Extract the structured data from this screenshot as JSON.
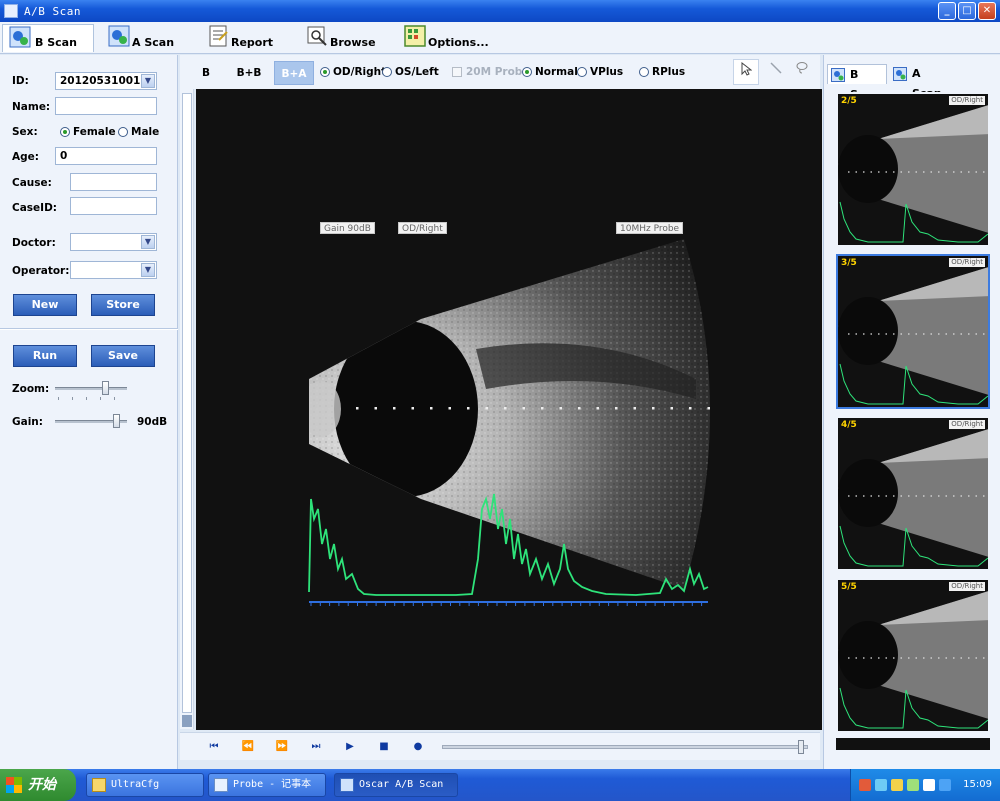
{
  "window": {
    "title": "A/B Scan",
    "controls": {
      "minimize": "_",
      "maximize": "□",
      "close": "✕"
    }
  },
  "toolbar": {
    "items": [
      {
        "label": "B Scan",
        "icon": "b-scan-icon",
        "active": true
      },
      {
        "label": "A Scan",
        "icon": "a-scan-icon",
        "active": false
      },
      {
        "label": "Report",
        "icon": "report-icon",
        "active": false
      },
      {
        "label": "Browse",
        "icon": "browse-icon",
        "active": false
      },
      {
        "label": "Options...",
        "icon": "options-icon",
        "active": false
      }
    ]
  },
  "patient": {
    "id_label": "ID:",
    "id_value": "20120531001",
    "name_label": "Name:",
    "name_value": "",
    "sex_label": "Sex:",
    "sex_female": "Female",
    "sex_male": "Male",
    "sex_selected": "Female",
    "age_label": "Age:",
    "age_value": "0",
    "cause_label": "Cause:",
    "cause_value": "",
    "caseid_label": "CaseID:",
    "caseid_value": "",
    "doctor_label": "Doctor:",
    "doctor_value": "",
    "operator_label": "Operator:",
    "operator_value": "",
    "new_label": "New",
    "store_label": "Store"
  },
  "controls": {
    "run_label": "Run",
    "save_label": "Save",
    "zoom_label": "Zoom:",
    "zoom_level": 0.7,
    "gain_label": "Gain:",
    "gain_value": "90dB",
    "gain_level": 0.85
  },
  "display_modes": {
    "b": "B",
    "bb": "B+B",
    "ba": "B+A",
    "active": "B+A",
    "od_right": "OD/Right",
    "os_left": "OS/Left",
    "eye_selected": "OD/Right",
    "probe_20m": "20M Prob",
    "normal": "Normal",
    "vplus": "VPlus",
    "rplus": "RPlus",
    "filter_selected": "Normal"
  },
  "tools": {
    "pointer": "pointer-icon",
    "line": "line-icon",
    "lasso": "lasso-icon"
  },
  "viewport": {
    "gain_tag": "Gain 90dB",
    "eye_tag": "OD/Right",
    "probe_tag": "10MHz Probe"
  },
  "playback": {
    "first": "⏮",
    "prev": "⏪",
    "next": "⏩",
    "last": "⏭",
    "play": "▶",
    "stop": "■",
    "record": "●",
    "position": 0.98
  },
  "side_tabs": {
    "bscan": "B Scan",
    "ascan": "A Scan"
  },
  "thumbnails": [
    {
      "index": "2/5",
      "tag": "OD/Right",
      "selected": false
    },
    {
      "index": "3/5",
      "tag": "OD/Right",
      "selected": true
    },
    {
      "index": "4/5",
      "tag": "OD/Right",
      "selected": false
    },
    {
      "index": "5/5",
      "tag": "OD/Right",
      "selected": false
    }
  ],
  "taskbar": {
    "start": "开始",
    "tasks": [
      {
        "label": "UltraCfg",
        "active": false
      },
      {
        "label": "Probe - 记事本",
        "active": false
      },
      {
        "label": "Oscar A/B Scan",
        "active": true
      }
    ],
    "clock": "15:09"
  },
  "colors": {
    "accent": "#2b5db8",
    "echo_trace": "#2ee37a",
    "baseline": "#2f6fe0",
    "viewport_bg": "#111111"
  }
}
